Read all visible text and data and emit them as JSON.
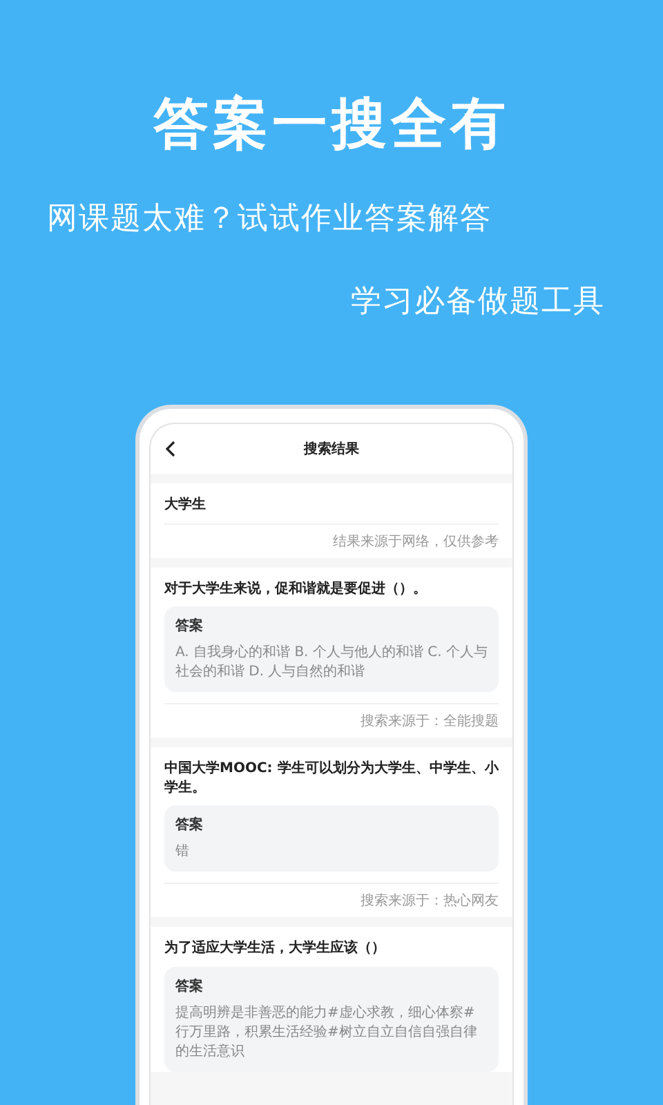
{
  "banner": {
    "headline": "答案一搜全有",
    "taglines": [
      "网课题太难？试试作业答案解答",
      "学习必备做题工具"
    ]
  },
  "screen": {
    "title": "搜索结果",
    "query": "大学生",
    "disclaimer": "结果来源于网络，仅供参考",
    "results": [
      {
        "question": "对于大学生来说，促和谐就是要促进（）。",
        "answer_label": "答案",
        "answer": "A. 自我身心的和谐 B. 个人与他人的和谐 C. 个人与社会的和谐 D. 人与自然的和谐",
        "source": "搜索来源于：全能搜题"
      },
      {
        "question": "中国大学MOOC: 学生可以划分为大学生、中学生、小学生。",
        "answer_label": "答案",
        "answer": "错",
        "source": "搜索来源于：热心网友"
      },
      {
        "question": "为了适应大学生活，大学生应该（）",
        "answer_label": "答案",
        "answer": "提高明辨是非善恶的能力#虚心求教，细心体察#行万里路，积累生活经验#树立自立自信自强自律的生活意识"
      }
    ]
  }
}
